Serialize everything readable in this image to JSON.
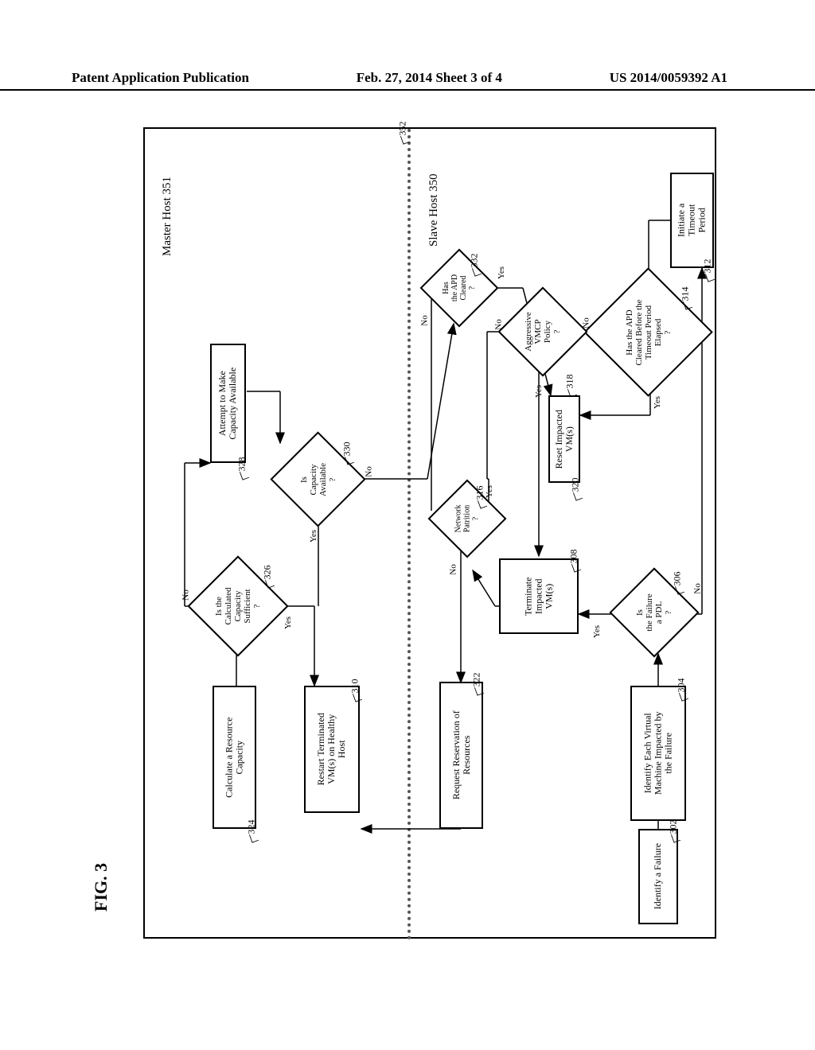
{
  "header": {
    "left": "Patent Application Publication",
    "mid": "Feb. 27, 2014   Sheet 3 of 4",
    "right": "US 2014/0059392 A1"
  },
  "figure_label": "FIG. 3",
  "columns": {
    "master": "Master Host 351",
    "slave": "Slave Host 350"
  },
  "divider_ref": "352",
  "nodes": {
    "n302": {
      "ref": "302",
      "text": "Identify a Failure"
    },
    "n304": {
      "ref": "304",
      "text": "Identify Each Virtual\nMachine Impacted by\nthe Failure"
    },
    "n306": {
      "ref": "306",
      "text": "Is\nthe Failure\na PDL\n?"
    },
    "n308": {
      "ref": "308",
      "text": "Terminate\nImpacted\nVM(s)"
    },
    "n310": {
      "ref": "310",
      "text": "Restart Terminated\nVM(s) on Healthy\nHost"
    },
    "n312": {
      "ref": "312",
      "text": "Initiate a\nTimeout\nPeriod"
    },
    "n314": {
      "ref": "314",
      "text": "Has the APD\nCleared Before the\nTimeout Period\nElapsed\n?"
    },
    "n316": {
      "ref": "316",
      "text": "Network\nPatrition\n?"
    },
    "n318": {
      "ref": "318",
      "text": "Aggressive\nVMCP\nPolicy\n?"
    },
    "n320": {
      "ref": "320",
      "text": "Reset Impacted\nVM(s)"
    },
    "n322": {
      "ref": "322",
      "text": "Request Reservation of\nResources"
    },
    "n324": {
      "ref": "324",
      "text": "Calculate a Resource\nCapacity"
    },
    "n326": {
      "ref": "326",
      "text": "Is the\nCalculated\nCapacity\nSufficient\n?"
    },
    "n328": {
      "ref": "328",
      "text": "Attempt to Make\nCapacity Available"
    },
    "n330": {
      "ref": "330",
      "text": "Is\nCapacity\nAvailable\n?"
    },
    "n332": {
      "ref": "332",
      "text": "Has\nthe APD\nCleared\n?"
    }
  },
  "labels": {
    "yes": "Yes",
    "no": "No"
  }
}
